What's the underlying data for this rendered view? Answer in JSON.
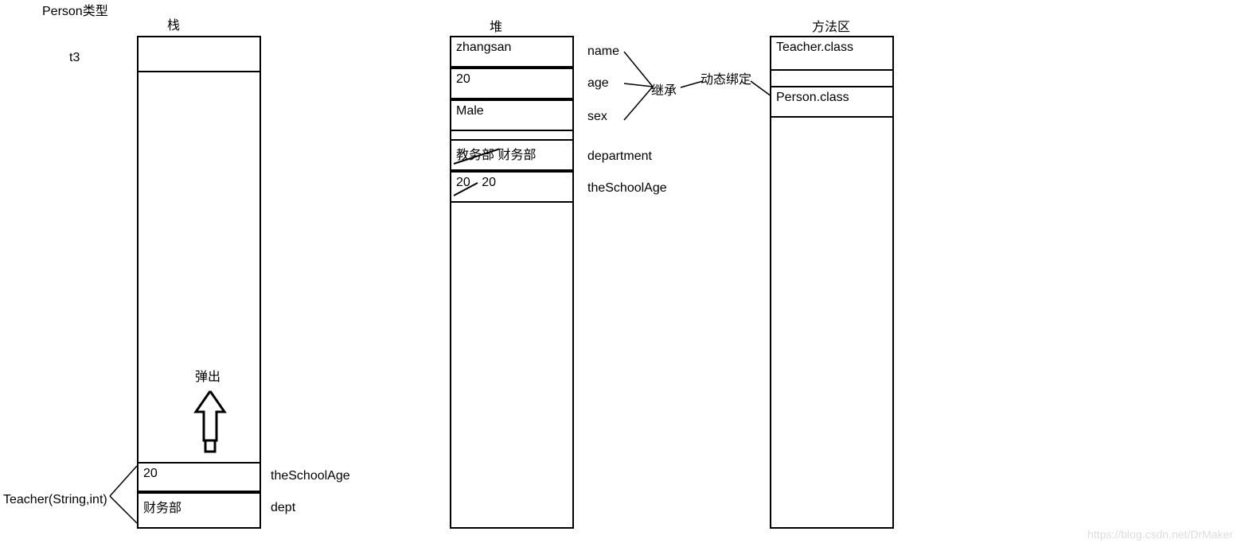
{
  "labels": {
    "person_type": "Person类型",
    "stack_title": "栈",
    "heap_title": "堆",
    "method_area_title": "方法区",
    "t3": "t3",
    "popup": "弹出",
    "teacher_ctor": "Teacher(String,int)",
    "dynamic_binding": "动态绑定",
    "inherit": "继承",
    "watermark": "https://blog.csdn.net/DrMaker"
  },
  "stack": {
    "theSchoolAge_value": "20",
    "theSchoolAge_label": "theSchoolAge",
    "dept_value": "财务部",
    "dept_label": "dept"
  },
  "heap": {
    "name_value": "zhangsan",
    "name_label": "name",
    "age_value": "20",
    "age_label": "age",
    "sex_value": "Male",
    "sex_label": "sex",
    "department_old": "教务部",
    "department_new": "财务部",
    "department_label": "department",
    "schoolage_old": "20",
    "schoolage_new": "20",
    "schoolage_label": "theSchoolAge"
  },
  "method_area": {
    "teacher_class": "Teacher.class",
    "person_class": "Person.class"
  }
}
